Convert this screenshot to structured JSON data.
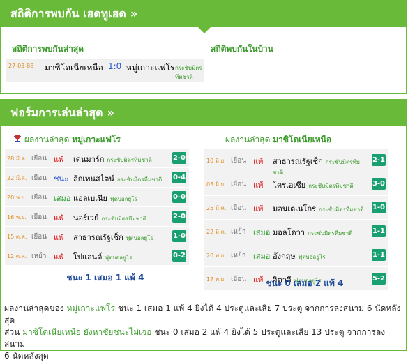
{
  "h2h": {
    "title": "สถิติการพบกัน เฮดทูเฮด",
    "chevron": "»",
    "latest_label": "สถิติการพบกันล่าสุด",
    "home_label": "สถิติพบกันในบ้าน",
    "meeting": {
      "date": "27-03-88",
      "home": "มาซิโดเนียเหนือ",
      "score": "1:0",
      "away": "หมู่เกาะแฟโร",
      "comp": "กระชับมิตรทีมชาติ"
    }
  },
  "form": {
    "title": "ฟอร์มการเล่นล่าสุด",
    "chevron": "»",
    "left_head_prefix": "ผลงานล่าสุด",
    "left_team": "หมู่เกาะแฟโร",
    "right_head_prefix": "ผลงานล่าสุด",
    "right_team": "มาซิโดเนียเหนือ",
    "left_rows": [
      {
        "date": "28 มี.ค.",
        "ha": "เยือน",
        "res": "แพ้",
        "kind": "loss",
        "opp": "เดนมาร์ก",
        "comp": "กระชับมิตรทีมชาติ",
        "score": "2-0"
      },
      {
        "date": "22 มี.ค.",
        "ha": "เยือน",
        "res": "ชนะ",
        "kind": "win",
        "opp": "ลิกเทนสไตน์",
        "comp": "กระชับมิตรทีมชาติ",
        "score": "0-4"
      },
      {
        "date": "20 พ.ย.",
        "ha": "เยือน",
        "res": "เสมอ",
        "kind": "draw",
        "opp": "แอลเบเนีย",
        "comp": "ฟุตบอลยูโร",
        "score": "0-0"
      },
      {
        "date": "16 พ.ย.",
        "ha": "เยือน",
        "res": "แพ้",
        "kind": "loss",
        "opp": "นอร์เวย์",
        "comp": "กระชับมิตรทีมชาติ",
        "score": "2-0"
      },
      {
        "date": "15 ต.ค.",
        "ha": "เยือน",
        "res": "แพ้",
        "kind": "loss",
        "opp": "สาธารณรัฐเช็ก",
        "comp": "ฟุตบอลยูโร",
        "score": "1-0"
      },
      {
        "date": "12 ต.ค.",
        "ha": "เหย้า",
        "res": "แพ้",
        "kind": "loss",
        "opp": "โปแลนด์",
        "comp": "ฟุตบอลยูโร",
        "score": "0-2"
      }
    ],
    "right_rows": [
      {
        "date": "10 มิ.ย.",
        "ha": "เยือน",
        "res": "แพ้",
        "kind": "loss",
        "opp": "สาธารณรัฐเช็ก",
        "comp": "กระชับมิตรทีมชาติ",
        "score": "2-1"
      },
      {
        "date": "03 มิ.ย.",
        "ha": "เยือน",
        "res": "แพ้",
        "kind": "loss",
        "opp": "โครเอเชีย",
        "comp": "กระชับมิตรทีมชาติ",
        "score": "3-0"
      },
      {
        "date": "25 มี.ค.",
        "ha": "เยือน",
        "res": "แพ้",
        "kind": "loss",
        "opp": "มอนเตเนโกร",
        "comp": "กระชับมิตรทีมชาติ",
        "score": "1-0"
      },
      {
        "date": "22 มี.ค.",
        "ha": "เหย้า",
        "res": "เสมอ",
        "kind": "draw",
        "opp": "มอลโดวา",
        "comp": "กระชับมิตรทีมชาติ",
        "score": "1-1"
      },
      {
        "date": "20 พ.ย.",
        "ha": "เหย้า",
        "res": "เสมอ",
        "kind": "draw",
        "opp": "อังกฤษ",
        "comp": "ฟุตบอลยูโร",
        "score": "1-1"
      },
      {
        "date": "17 พ.ย.",
        "ha": "เยือน",
        "res": "แพ้",
        "kind": "loss",
        "opp": "อิตาลี",
        "comp": "ฟุตบอลยูโร",
        "score": "5-2"
      }
    ],
    "left_summary": "ชนะ 1 เสมอ 1 แพ้ 4",
    "right_summary": "ชนะ 0 เสมอ 2 แพ้ 4",
    "footer_1a": "ผลงานล่าสุดของ ",
    "footer_team1": "หมู่เกาะแฟโร",
    "footer_1b": " ชนะ 1 เสมอ 1 แพ้ 4 ยิงได้ 4 ประตูและเสีย 7 ประตู จากการลงสนาม 6 นัดหลังสุด",
    "footer_2a": "ส่วน ",
    "footer_team2": "มาซิโดเนียเหนือ ยังหาชัยชนะไม่เจอ",
    "footer_2b": " ชนะ 0 เสมอ 2 แพ้ 4 ยิงได้ 5 ประตูและเสีย 13 ประตู จากการลงสนาม",
    "footer_3": "6 นัดหลังสุด"
  },
  "colors": {
    "green": "#6aba3a",
    "badge": "#1aa070",
    "loss": "#d11111",
    "win": "#2a55c8",
    "draw": "#2a9a2a"
  }
}
